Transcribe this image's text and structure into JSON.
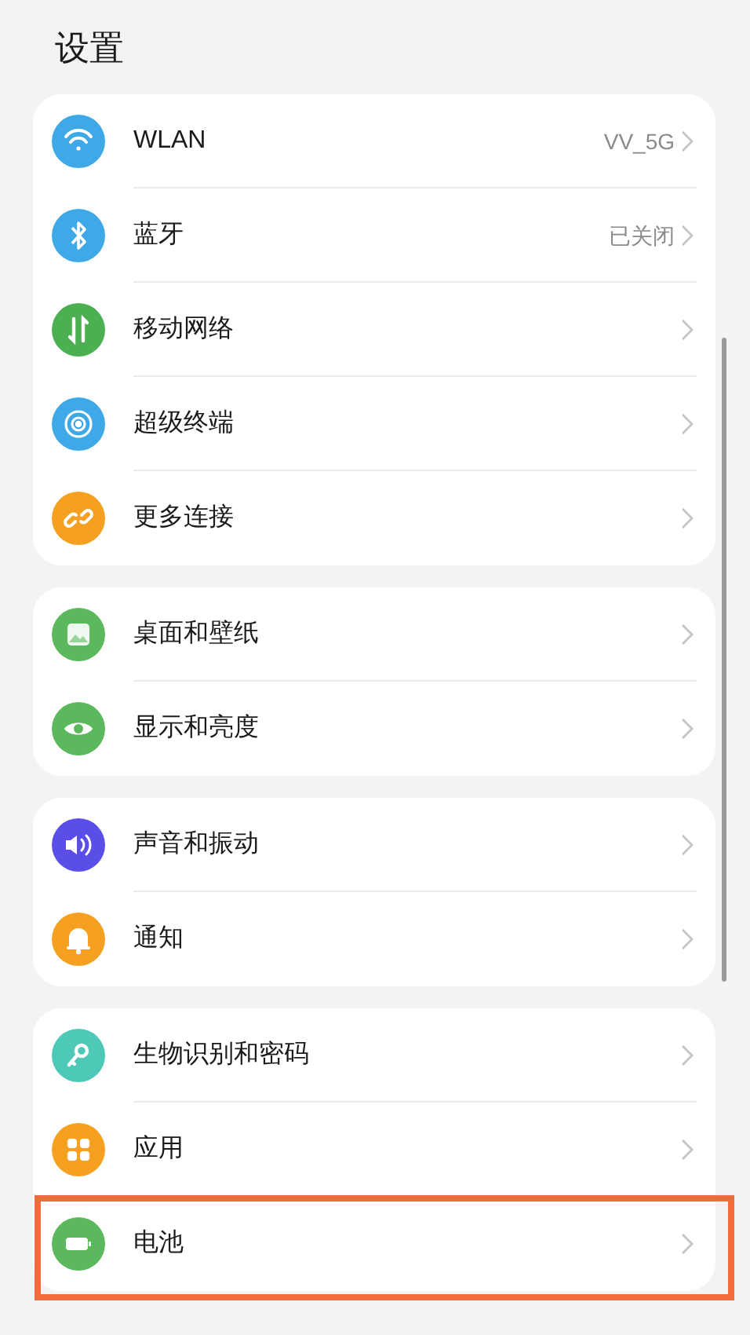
{
  "title": "设置",
  "sections": [
    {
      "items": [
        {
          "label": "WLAN",
          "value": "VV_5G",
          "color": "#3fa9e8"
        },
        {
          "label": "蓝牙",
          "value": "已关闭",
          "color": "#3fa9e8"
        },
        {
          "label": "移动网络",
          "color": "#4caf50"
        },
        {
          "label": "超级终端",
          "color": "#3fa9e8"
        },
        {
          "label": "更多连接",
          "color": "#f5a020"
        }
      ]
    },
    {
      "items": [
        {
          "label": "桌面和壁纸",
          "color": "#5cb85c"
        },
        {
          "label": "显示和亮度",
          "color": "#5cb85c"
        }
      ]
    },
    {
      "items": [
        {
          "label": "声音和振动",
          "color": "#5b4ee8"
        },
        {
          "label": "通知",
          "color": "#f5a020"
        }
      ]
    },
    {
      "items": [
        {
          "label": "生物识别和密码",
          "color": "#4ec9b8"
        },
        {
          "label": "应用",
          "color": "#f5a020"
        },
        {
          "label": "电池",
          "color": "#5cb85c",
          "highlighted": true
        }
      ]
    }
  ]
}
